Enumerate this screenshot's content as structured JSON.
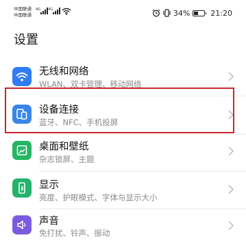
{
  "status_bar": {
    "carrier_1": "中国联通",
    "carrier_2": "中国联通",
    "sig1_label": "4G",
    "sig2_label": "4G",
    "battery_percent": "34%",
    "time": "21:20",
    "icons": [
      "alarm-icon",
      "vibrate-icon",
      "battery-icon",
      "wifi-icon",
      "signal-icon"
    ]
  },
  "page": {
    "title": "设置"
  },
  "settings_items": [
    {
      "title": "无线和网络",
      "subtitle": "WLAN、双卡管理、移动网络",
      "icon": "wifi-icon",
      "icon_color": "#2f7cf6"
    },
    {
      "title": "设备连接",
      "subtitle": "蓝牙、NFC、手机投屏",
      "icon": "device-connection-icon",
      "icon_color": "#3a86e8"
    },
    {
      "title": "桌面和壁纸",
      "subtitle": "杂志锁屏、主题",
      "icon": "wallpaper-icon",
      "icon_color": "#26b563"
    },
    {
      "title": "显示",
      "subtitle": "亮度、护眼模式、字体与显示大小",
      "icon": "display-icon",
      "icon_color": "#24b36b"
    },
    {
      "title": "声音",
      "subtitle": "免打扰、铃声、振动",
      "icon": "sound-icon",
      "icon_color": "#7b5be0"
    }
  ],
  "highlight_color": "#c9242b"
}
